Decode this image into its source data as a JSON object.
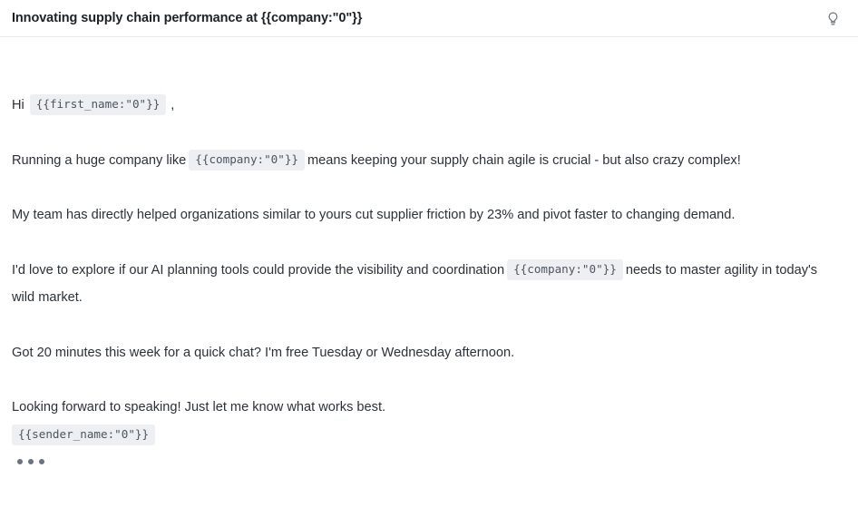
{
  "header": {
    "subject": "Innovating supply chain performance at {{company:\"0\"}}",
    "bulb_icon_name": "lightbulb-icon"
  },
  "email": {
    "greeting_prefix": "Hi",
    "greeting_token": "{{first_name:\"0\"}}",
    "greeting_suffix": ",",
    "paragraph_2": {
      "before": "Running a huge company like",
      "token": "{{company:\"0\"}}",
      "after": "means keeping your supply chain agile is crucial - but also crazy complex!"
    },
    "paragraph_3": "My team has directly helped organizations similar to yours cut supplier friction by 23% and pivot faster to changing demand.",
    "paragraph_4": {
      "before": "I'd love to explore if our AI planning tools could provide the visibility and coordination",
      "token": "{{company:\"0\"}}",
      "after": "needs to master agility in today's wild market."
    },
    "paragraph_5": "Got 20 minutes this week for a quick chat? I'm free Tuesday or Wednesday afternoon.",
    "paragraph_6": "Looking forward to speaking! Just let me know what works best.",
    "signature_token": "{{sender_name:\"0\"}}"
  },
  "typing_indicator": {
    "dot_count": 3,
    "color": "#6b7280"
  },
  "colors": {
    "page_background": "#ffffff",
    "text": "#2b3138",
    "heading": "#1d2227",
    "token_background": "#edeff2",
    "token_text": "#4d5560",
    "divider": "#e8eaed"
  }
}
